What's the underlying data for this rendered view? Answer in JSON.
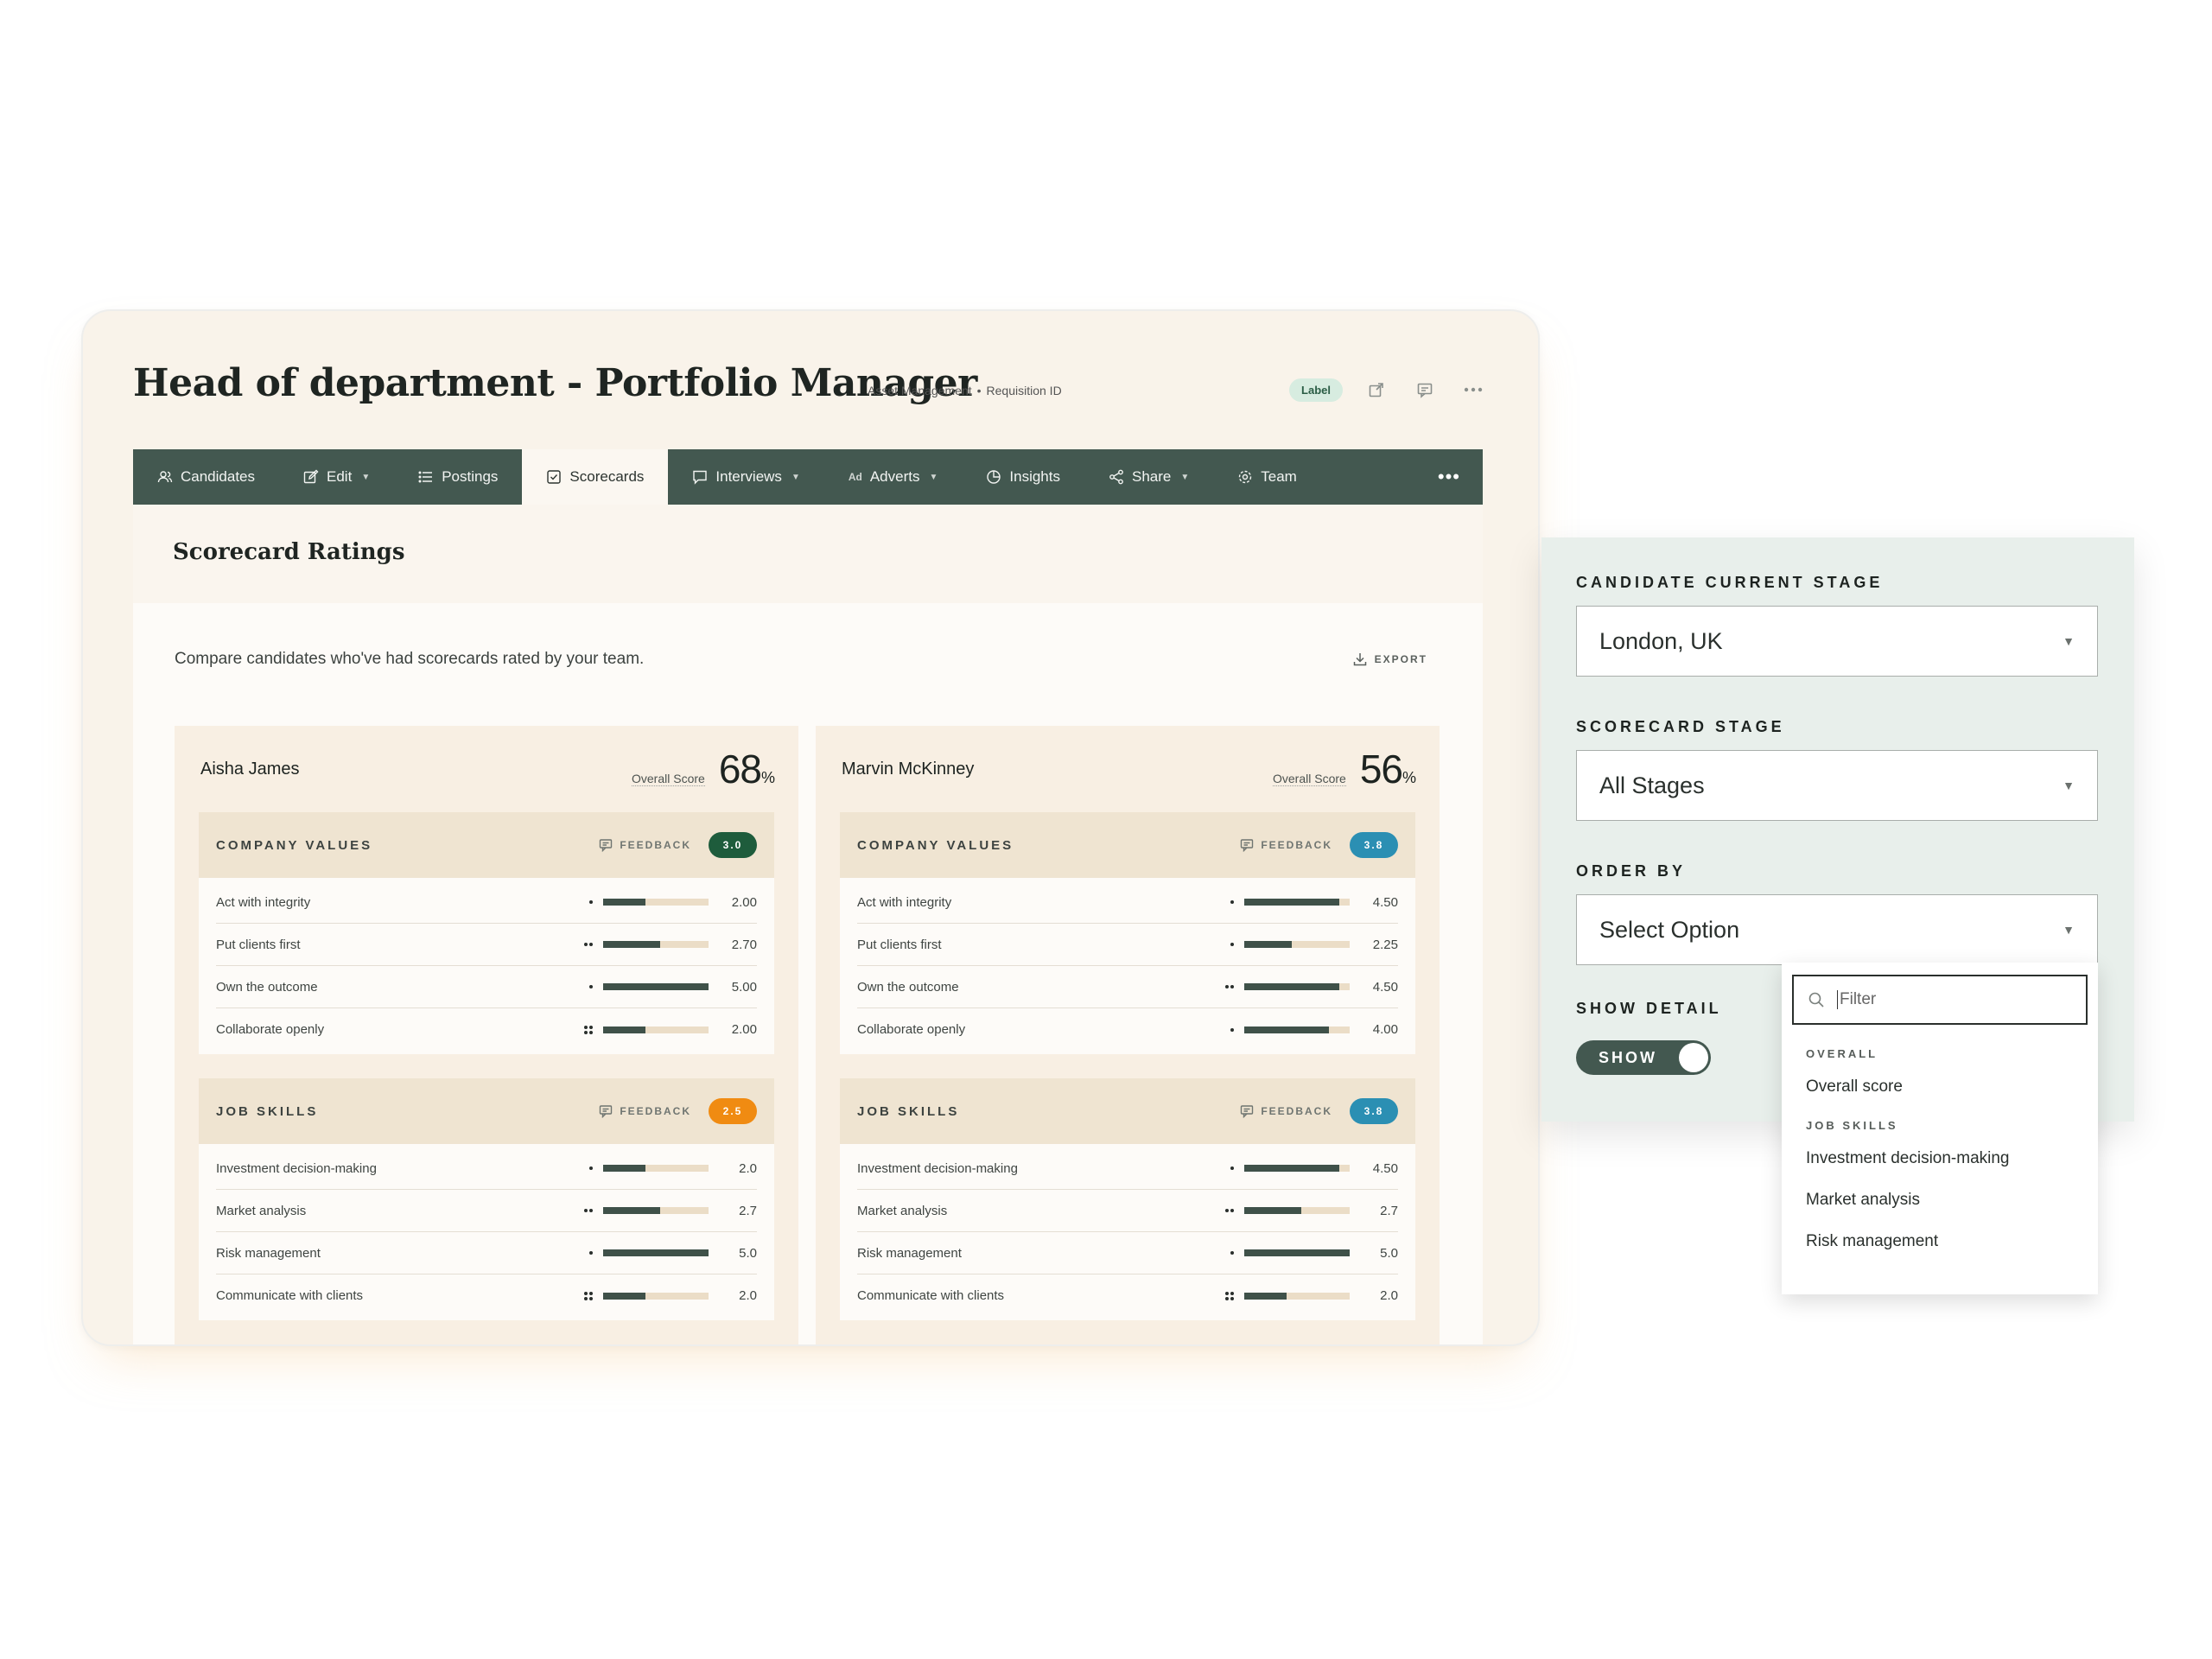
{
  "header": {
    "title": "Head of department - Portfolio Manager",
    "meta_department": "Asset Management",
    "meta_requisition": "Requisition ID",
    "label_badge": "Label"
  },
  "tabs": [
    {
      "label": "Candidates",
      "icon": "users-icon"
    },
    {
      "label": "Edit",
      "icon": "edit-icon",
      "dropdown": true
    },
    {
      "label": "Postings",
      "icon": "list-icon"
    },
    {
      "label": "Scorecards",
      "icon": "checkbox-icon",
      "active": true
    },
    {
      "label": "Interviews",
      "icon": "chat-icon",
      "dropdown": true
    },
    {
      "label": "Adverts",
      "icon": "ad-icon",
      "dropdown": true
    },
    {
      "label": "Insights",
      "icon": "pie-icon"
    },
    {
      "label": "Share",
      "icon": "share-icon",
      "dropdown": true
    },
    {
      "label": "Team",
      "icon": "gear-icon"
    }
  ],
  "content": {
    "section_title": "Scorecard Ratings",
    "description": "Compare candidates who've had scorecards rated by your team.",
    "export_label": "EXPORT",
    "overall_label": "Overall Score",
    "feedback_label": "FEEDBACK"
  },
  "candidates": [
    {
      "name": "Aisha James",
      "overall_score": "68",
      "groups": [
        {
          "title": "COMPANY VALUES",
          "score": "3.0",
          "score_color": "#1e5c3c",
          "rows": [
            {
              "label": "Act with integrity",
              "dots": 1,
              "fill": 0.4,
              "value": "2.00"
            },
            {
              "label": "Put clients first",
              "dots": 2,
              "fill": 0.54,
              "value": "2.70"
            },
            {
              "label": "Own the outcome",
              "dots": 1,
              "fill": 1.0,
              "value": "5.00"
            },
            {
              "label": "Collaborate openly",
              "dots": 4,
              "fill": 0.4,
              "value": "2.00"
            }
          ]
        },
        {
          "title": "JOB SKILLS",
          "score": "2.5",
          "score_color": "#f08b12",
          "rows": [
            {
              "label": "Investment decision-making",
              "dots": 1,
              "fill": 0.4,
              "value": "2.0"
            },
            {
              "label": "Market analysis",
              "dots": 2,
              "fill": 0.54,
              "value": "2.7"
            },
            {
              "label": "Risk management",
              "dots": 1,
              "fill": 1.0,
              "value": "5.0"
            },
            {
              "label": "Communicate with clients",
              "dots": 4,
              "fill": 0.4,
              "value": "2.0"
            }
          ]
        }
      ]
    },
    {
      "name": "Marvin McKinney",
      "overall_score": "56",
      "groups": [
        {
          "title": "COMPANY VALUES",
          "score": "3.8",
          "score_color": "#2b8fb3",
          "rows": [
            {
              "label": "Act with integrity",
              "dots": 1,
              "fill": 0.9,
              "value": "4.50"
            },
            {
              "label": "Put clients first",
              "dots": 1,
              "fill": 0.45,
              "value": "2.25"
            },
            {
              "label": "Own the outcome",
              "dots": 2,
              "fill": 0.9,
              "value": "4.50"
            },
            {
              "label": "Collaborate openly",
              "dots": 1,
              "fill": 0.8,
              "value": "4.00"
            }
          ]
        },
        {
          "title": "JOB SKILLS",
          "score": "3.8",
          "score_color": "#2b8fb3",
          "rows": [
            {
              "label": "Investment decision-making",
              "dots": 1,
              "fill": 0.9,
              "value": "4.50"
            },
            {
              "label": "Market analysis",
              "dots": 2,
              "fill": 0.54,
              "value": "2.7"
            },
            {
              "label": "Risk management",
              "dots": 1,
              "fill": 1.0,
              "value": "5.0"
            },
            {
              "label": "Communicate with clients",
              "dots": 4,
              "fill": 0.4,
              "value": "2.0"
            }
          ]
        }
      ]
    }
  ],
  "filters": {
    "stage_label": "CANDIDATE CURRENT STAGE",
    "stage_value": "London, UK",
    "scorecard_label": "SCORECARD STAGE",
    "scorecard_value": "All Stages",
    "order_label": "ORDER BY",
    "order_value": "Select Option",
    "detail_label": "SHOW DETAIL",
    "toggle_text": "SHOW"
  },
  "dropdown": {
    "filter_placeholder": "Filter",
    "section_overall": "OVERALL",
    "item_overall": "Overall score",
    "section_job": "JOB SKILLS",
    "items_job": [
      "Investment decision-making",
      "Market analysis",
      "Risk management"
    ]
  }
}
